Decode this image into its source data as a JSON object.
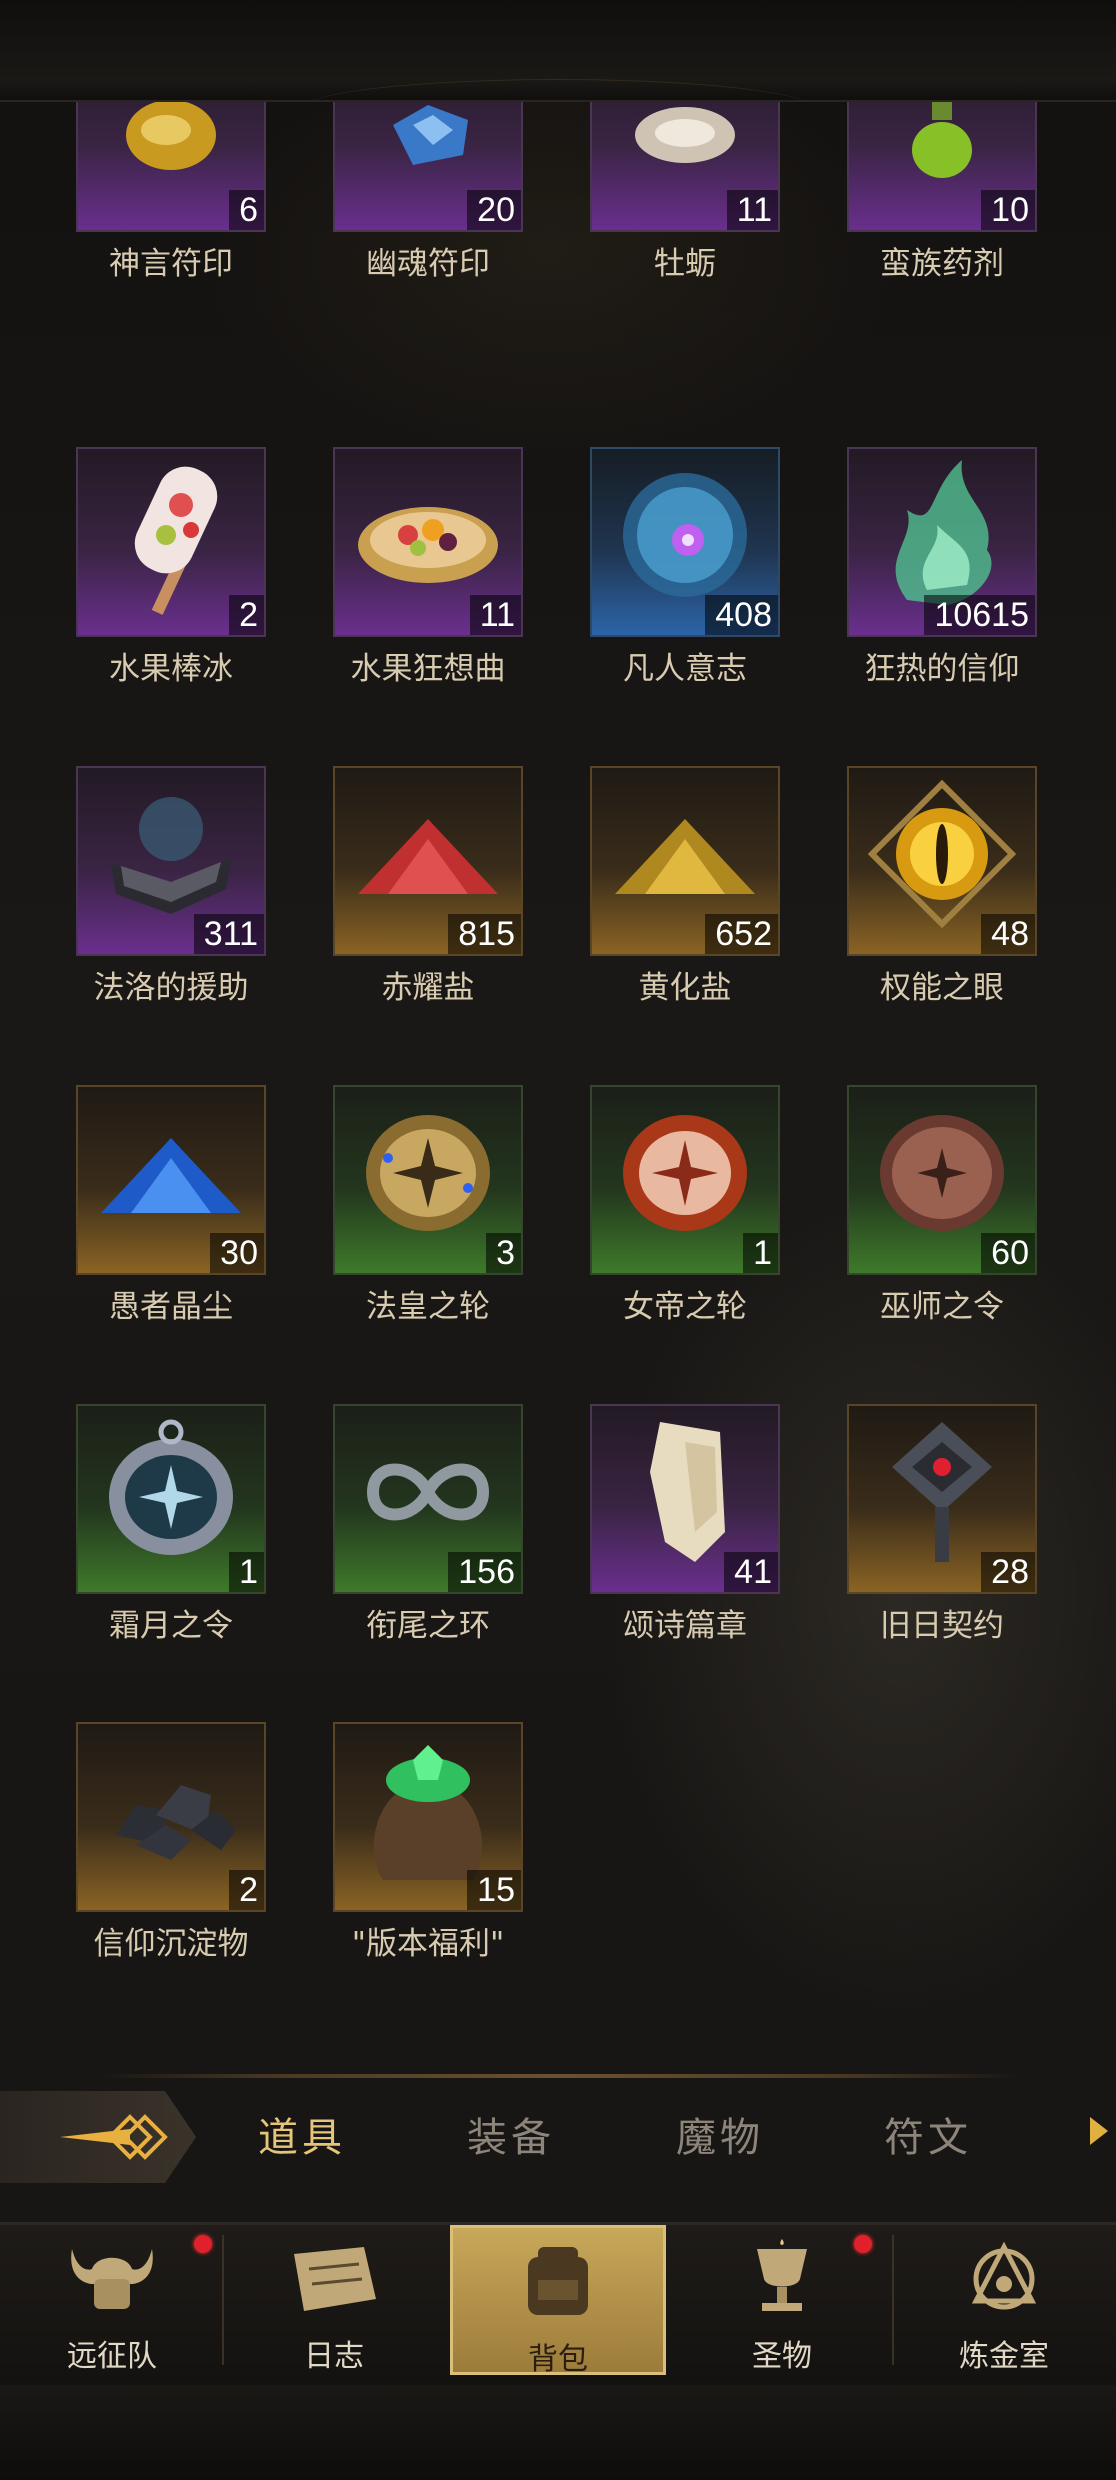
{
  "items": [
    {
      "name": "神言符印",
      "count": "6",
      "rarity": "purple",
      "icon": "amber-sigil-icon"
    },
    {
      "name": "幽魂符印",
      "count": "20",
      "rarity": "purple",
      "icon": "blue-crystal-sigil-icon"
    },
    {
      "name": "牡蛎",
      "count": "11",
      "rarity": "purple",
      "icon": "oyster-icon"
    },
    {
      "name": "蛮族药剂",
      "count": "10",
      "rarity": "purple",
      "icon": "green-potion-icon"
    },
    {
      "name": "水果棒冰",
      "count": "2",
      "rarity": "purple",
      "icon": "popsicle-icon"
    },
    {
      "name": "水果狂想曲",
      "count": "11",
      "rarity": "purple",
      "icon": "fruit-platter-icon"
    },
    {
      "name": "凡人意志",
      "count": "408",
      "rarity": "blue",
      "icon": "glowing-orb-icon"
    },
    {
      "name": "狂热的信仰",
      "count": "10615",
      "rarity": "purple",
      "icon": "green-flame-icon"
    },
    {
      "name": "法洛的援助",
      "count": "311",
      "rarity": "purple",
      "icon": "spellbook-icon"
    },
    {
      "name": "赤耀盐",
      "count": "815",
      "rarity": "gold",
      "icon": "red-salt-icon"
    },
    {
      "name": "黄化盐",
      "count": "652",
      "rarity": "gold",
      "icon": "yellow-salt-icon"
    },
    {
      "name": "权能之眼",
      "count": "48",
      "rarity": "gold",
      "icon": "golden-eye-icon"
    },
    {
      "name": "愚者晶尘",
      "count": "30",
      "rarity": "gold",
      "icon": "blue-dust-icon"
    },
    {
      "name": "法皇之轮",
      "count": "3",
      "rarity": "green",
      "icon": "gold-disc-icon"
    },
    {
      "name": "女帝之轮",
      "count": "1",
      "rarity": "green",
      "icon": "red-disc-icon"
    },
    {
      "name": "巫师之令",
      "count": "60",
      "rarity": "green",
      "icon": "bronze-disc-icon"
    },
    {
      "name": "霜月之令",
      "count": "1",
      "rarity": "green",
      "icon": "silver-amulet-icon"
    },
    {
      "name": "衔尾之环",
      "count": "156",
      "rarity": "green",
      "icon": "ouroboros-icon"
    },
    {
      "name": "颂诗篇章",
      "count": "41",
      "rarity": "purple",
      "icon": "parchment-icon"
    },
    {
      "name": "旧日契约",
      "count": "28",
      "rarity": "gold",
      "icon": "dark-seal-icon"
    },
    {
      "name": "信仰沉淀物",
      "count": "2",
      "rarity": "gold",
      "icon": "ore-chunks-icon"
    },
    {
      "name": "\"版本福利\"",
      "count": "15",
      "rarity": "gold",
      "icon": "gem-pouch-icon"
    }
  ],
  "tabs": [
    {
      "label": "道具",
      "active": true
    },
    {
      "label": "装备",
      "active": false
    },
    {
      "label": "魔物",
      "active": false
    },
    {
      "label": "符文",
      "active": false
    }
  ],
  "nav": [
    {
      "label": "远征队",
      "badge": true,
      "icon": "horned-helmet-icon",
      "active": false
    },
    {
      "label": "日志",
      "badge": false,
      "icon": "scroll-icon",
      "active": false
    },
    {
      "label": "背包",
      "badge": false,
      "icon": "backpack-icon",
      "active": true
    },
    {
      "label": "圣物",
      "badge": true,
      "icon": "chalice-icon",
      "active": false
    },
    {
      "label": "炼金室",
      "badge": false,
      "icon": "alchemy-icon",
      "active": false
    }
  ],
  "colors": {
    "accent": "#e6c47a",
    "badge": "#e0202a",
    "active_nav": "#c8a85a"
  }
}
